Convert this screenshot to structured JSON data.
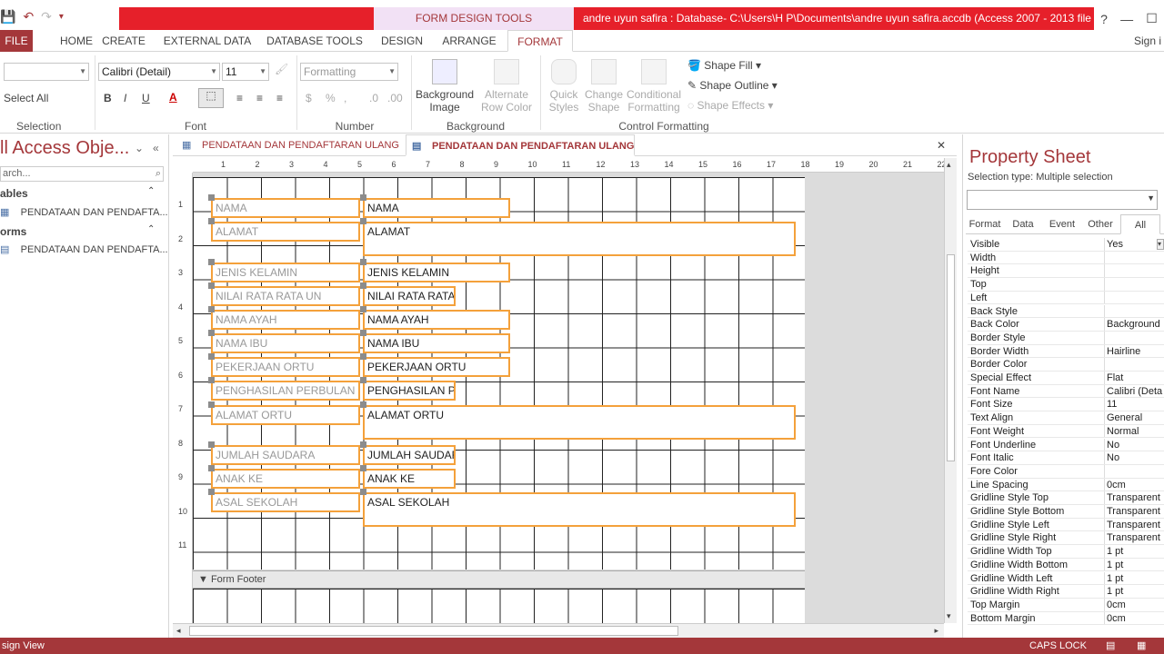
{
  "window": {
    "tools_tab": "FORM DESIGN TOOLS",
    "title": "andre uyun safira : Database- C:\\Users\\H P\\Documents\\andre uyun safira.accdb (Access 2007 - 2013 file f...",
    "help": "?",
    "minimize": "—",
    "restore": "☐"
  },
  "ribbon_tabs": {
    "file": "FILE",
    "home": "HOME",
    "create": "CREATE",
    "external": "EXTERNAL DATA",
    "dbtools": "DATABASE TOOLS",
    "design": "DESIGN",
    "arrange": "ARRANGE",
    "format": "FORMAT",
    "signin": "Sign i"
  },
  "ribbon": {
    "select_all": "Select All",
    "selection_label": "Selection",
    "font_name": "Calibri (Detail)",
    "font_size": "11",
    "font_label": "Font",
    "formatting": "Formatting",
    "number_label": "Number",
    "bg_image": "Background Image",
    "alt_row": "Alternate Row Color",
    "background_label": "Background",
    "quick_styles": "Quick Styles",
    "change_shape": "Change Shape",
    "cond_format": "Conditional Formatting",
    "shape_fill": "Shape Fill",
    "shape_outline": "Shape Outline",
    "shape_effects": "Shape Effects",
    "control_fmt_label": "Control Formatting"
  },
  "nav": {
    "title": "ll Access Obje...",
    "search": "arch...",
    "tables": "ables",
    "table_item": "PENDATAAN DAN PENDAFTA...",
    "forms": "orms",
    "form_item": "PENDATAAN DAN PENDAFTA..."
  },
  "doc_tabs": {
    "tab1": "PENDATAAN DAN PENDAFTARAN ULANG",
    "tab2": "PENDATAAN DAN PENDAFTARAN ULANG",
    "close": "✕"
  },
  "form": {
    "footer_label": "Form Footer",
    "fields": [
      {
        "label": "NAMA",
        "text": "NAMA"
      },
      {
        "label": "ALAMAT",
        "text": "ALAMAT"
      },
      {
        "label": "JENIS KELAMIN",
        "text": "JENIS KELAMIN"
      },
      {
        "label": "NILAI RATA RATA UN",
        "text": "NILAI RATA RATA"
      },
      {
        "label": "NAMA AYAH",
        "text": "NAMA AYAH"
      },
      {
        "label": "NAMA IBU",
        "text": "NAMA IBU"
      },
      {
        "label": "PEKERJAAN ORTU",
        "text": "PEKERJAAN ORTU"
      },
      {
        "label": "PENGHASILAN PERBULAN",
        "text": "PENGHASILAN P"
      },
      {
        "label": "ALAMAT ORTU",
        "text": "ALAMAT ORTU"
      },
      {
        "label": "JUMLAH SAUDARA",
        "text": "JUMLAH SAUDAR"
      },
      {
        "label": "ANAK KE",
        "text": "ANAK KE"
      },
      {
        "label": "ASAL SEKOLAH",
        "text": "ASAL SEKOLAH"
      }
    ]
  },
  "ruler": {
    "top": [
      "1",
      "2",
      "3",
      "4",
      "5",
      "6",
      "7",
      "8",
      "9",
      "10",
      "11",
      "12",
      "13",
      "14",
      "15",
      "16",
      "17",
      "18",
      "19",
      "20",
      "21",
      "22"
    ],
    "left": [
      "1",
      "2",
      "3",
      "4",
      "5",
      "6",
      "7",
      "8",
      "9",
      "10",
      "11"
    ]
  },
  "property_sheet": {
    "title": "Property Sheet",
    "selection_type": "Selection type:  Multiple selection",
    "tabs": [
      "Format",
      "Data",
      "Event",
      "Other",
      "All"
    ],
    "rows": [
      {
        "k": "Visible",
        "v": "Yes"
      },
      {
        "k": "Width",
        "v": ""
      },
      {
        "k": "Height",
        "v": ""
      },
      {
        "k": "Top",
        "v": ""
      },
      {
        "k": "Left",
        "v": ""
      },
      {
        "k": "Back Style",
        "v": ""
      },
      {
        "k": "Back Color",
        "v": "Background"
      },
      {
        "k": "Border Style",
        "v": ""
      },
      {
        "k": "Border Width",
        "v": "Hairline"
      },
      {
        "k": "Border Color",
        "v": ""
      },
      {
        "k": "Special Effect",
        "v": "Flat"
      },
      {
        "k": "Font Name",
        "v": "Calibri (Deta"
      },
      {
        "k": "Font Size",
        "v": "11"
      },
      {
        "k": "Text Align",
        "v": "General"
      },
      {
        "k": "Font Weight",
        "v": "Normal"
      },
      {
        "k": "Font Underline",
        "v": "No"
      },
      {
        "k": "Font Italic",
        "v": "No"
      },
      {
        "k": "Fore Color",
        "v": ""
      },
      {
        "k": "Line Spacing",
        "v": "0cm"
      },
      {
        "k": "Gridline Style Top",
        "v": "Transparent"
      },
      {
        "k": "Gridline Style Bottom",
        "v": "Transparent"
      },
      {
        "k": "Gridline Style Left",
        "v": "Transparent"
      },
      {
        "k": "Gridline Style Right",
        "v": "Transparent"
      },
      {
        "k": "Gridline Width Top",
        "v": "1 pt"
      },
      {
        "k": "Gridline Width Bottom",
        "v": "1 pt"
      },
      {
        "k": "Gridline Width Left",
        "v": "1 pt"
      },
      {
        "k": "Gridline Width Right",
        "v": "1 pt"
      },
      {
        "k": "Top Margin",
        "v": "0cm"
      },
      {
        "k": "Bottom Margin",
        "v": "0cm"
      }
    ]
  },
  "status": {
    "left": "sign View",
    "caps": "CAPS LOCK"
  },
  "colors": {
    "accent": "#a4373a",
    "select": "#f4a13b",
    "title_red": "#e6202a"
  }
}
